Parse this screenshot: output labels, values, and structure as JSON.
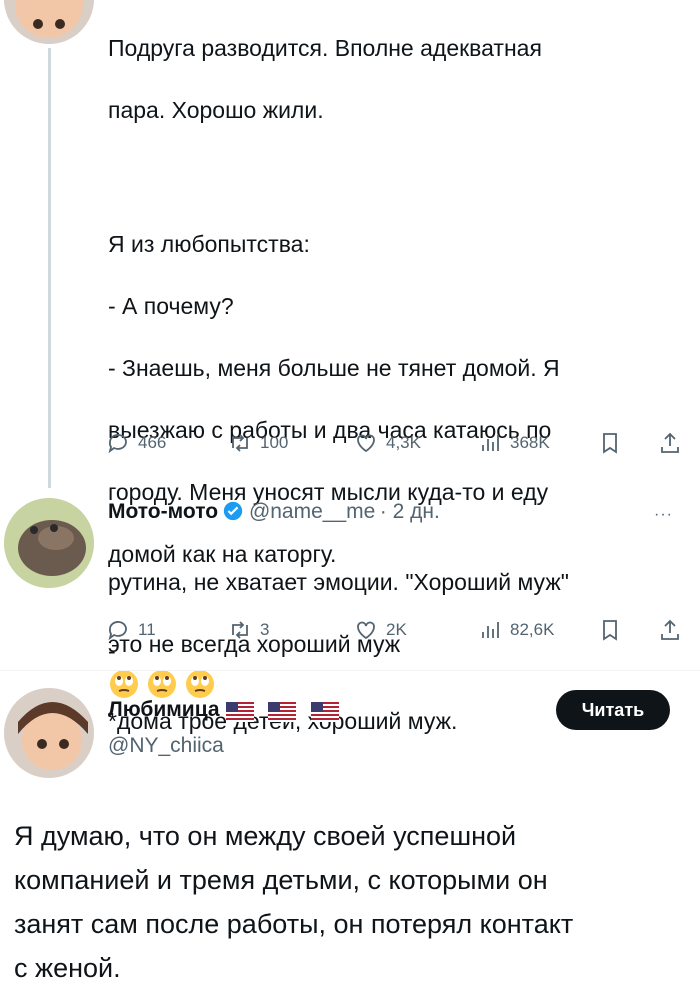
{
  "tweet1": {
    "lines": [
      "Подруга разводится. Вполне адекватная",
      "пара. Хорошо жили.",
      "",
      "Я из любопытства:",
      "- А почему?",
      "- Знаешь, меня больше не тянет домой. Я",
      "выезжаю с работы и два часа катаюсь по",
      "городу. Меня уносят мысли куда-то и еду",
      "домой как на каторгу."
    ],
    "emoji_prefix": "-",
    "emoji_name": "face-with-rolling-eyes-emoji",
    "footnote": "*дома трое детей, хороший муж.",
    "stats": {
      "replies": "466",
      "retweets": "100",
      "likes": "4,3K",
      "views": "368K"
    }
  },
  "tweet2": {
    "name": "Мото-мото",
    "handle": "@name__me",
    "time": "· 2 дн.",
    "lines": [
      "рутина, не хватает эмоции. \"Хороший муж\"",
      "это не всегда хороший муж"
    ],
    "stats": {
      "replies": "11",
      "retweets": "3",
      "likes": "2K",
      "views": "82,6K"
    }
  },
  "tweet3": {
    "name": "Любимица",
    "handle": "@NY_chiica",
    "follow_label": "Читать",
    "flag_icon": "us-flag-icon",
    "lines": [
      "Я думаю, что он между своей успешной",
      "компанией и тремя детьми, с которыми он",
      "занят сам после работы, он потерял контакт",
      "с женой."
    ]
  },
  "colors": {
    "accent": "#1d9bf0",
    "muted": "#536471",
    "line": "#cfd9de"
  }
}
